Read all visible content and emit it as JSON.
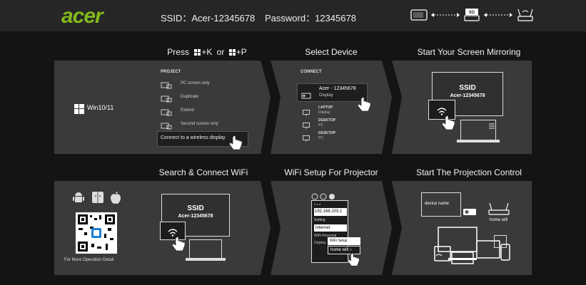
{
  "header": {
    "logo": "acer",
    "ssid": "SSID：Acer-12345678",
    "password": "Password：12345678",
    "badge_5g": "5G"
  },
  "steps": {
    "press": {
      "prefix": "Press",
      "k": "+K",
      "or": "or",
      "p": "+P"
    },
    "select_device": "Select Device",
    "start_mirroring": "Start Your Screen Mirroring",
    "search_connect": "Search & Connect WiFi",
    "wifi_setup": "WiFi Setup For Projector",
    "start_projection": "Start The Projection Control"
  },
  "panel1": {
    "os": "Win10/11",
    "project_header": "PROJECT",
    "options": [
      "PC screen only",
      "Duplicate",
      "Extend",
      "Second screen only"
    ],
    "connect_wireless": "Connect to a wireless display"
  },
  "panel2": {
    "connect_header": "CONNECT",
    "selected_name": "Acer - 12345678",
    "selected_type": "Display",
    "items": [
      {
        "name": "LAPTOP",
        "type": "Display"
      },
      {
        "name": "DESKTOP",
        "type": "PC"
      },
      {
        "name": "DESKTOP",
        "type": "PC"
      }
    ]
  },
  "panel3": {
    "ssid": "SSID",
    "name": "Acer-12345678"
  },
  "panel4": {
    "ssid": "SSID",
    "name": "Acer-12345678",
    "footer": "For More Operation Detail"
  },
  "panel5": {
    "ip": "192.168.203.1",
    "setting": "Setting",
    "internet": "Internet",
    "wifi_personal": "WiFi-Personal",
    "display": "Display",
    "wifi_setup": "WiFi Setup",
    "home_wifi": "home wifi"
  },
  "panel6": {
    "device_name": "device name",
    "home_wifi": "home wifi"
  },
  "colors": {
    "brand": "#83b81a",
    "panel": "#3a3a3a",
    "background": "#141414"
  }
}
